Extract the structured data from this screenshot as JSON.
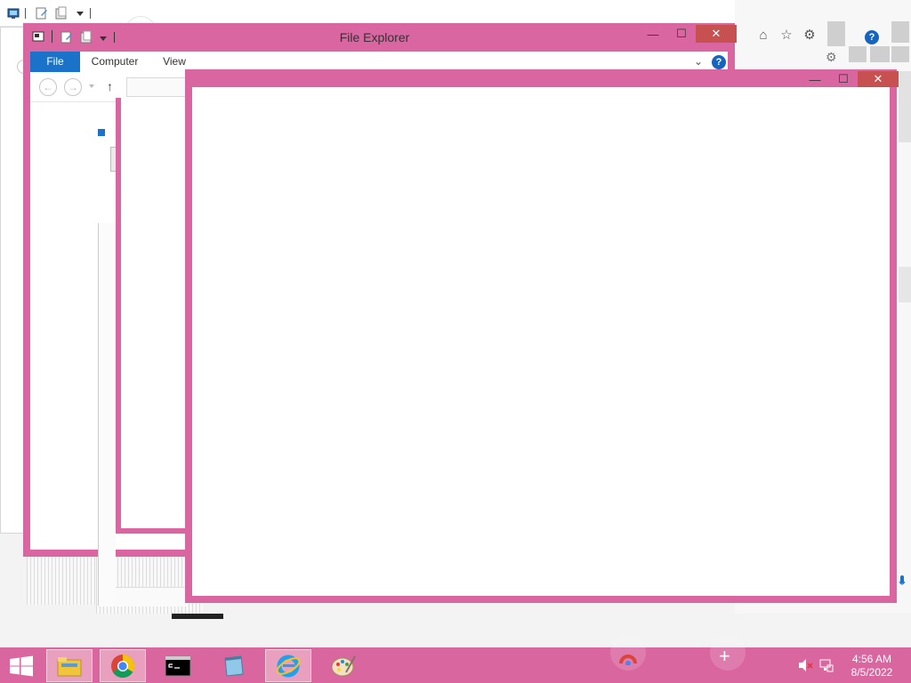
{
  "background": {
    "close_glyph": "✕",
    "minimize_glyph": "—",
    "maximize_glyph": "☐",
    "help_glyph": "?"
  },
  "file_explorer": {
    "title": "File Explorer",
    "tabs": [
      {
        "label": "File"
      },
      {
        "label": "Computer"
      },
      {
        "label": "View"
      }
    ],
    "help_glyph": "?",
    "back_glyph": "←",
    "forward_glyph": "→",
    "up_glyph": "↑"
  },
  "cmd": {
    "lines": [
      "<c",
      "C:"
    ]
  },
  "taskbar": {
    "items": [
      {
        "name": "file-explorer",
        "active": true
      },
      {
        "name": "chrome",
        "active": true
      },
      {
        "name": "command-prompt",
        "active": false
      },
      {
        "name": "notepad-app",
        "active": false
      },
      {
        "name": "internet-explorer",
        "active": true
      },
      {
        "name": "paint",
        "active": false
      }
    ],
    "clock_time": "4:56 AM",
    "clock_date": "8/5/2022",
    "plus_glyph": "+"
  },
  "colors": {
    "window_frame": "#d966a0",
    "taskbar": "#d9669f",
    "accent_blue": "#1a73c8",
    "close_red": "#c75050"
  }
}
